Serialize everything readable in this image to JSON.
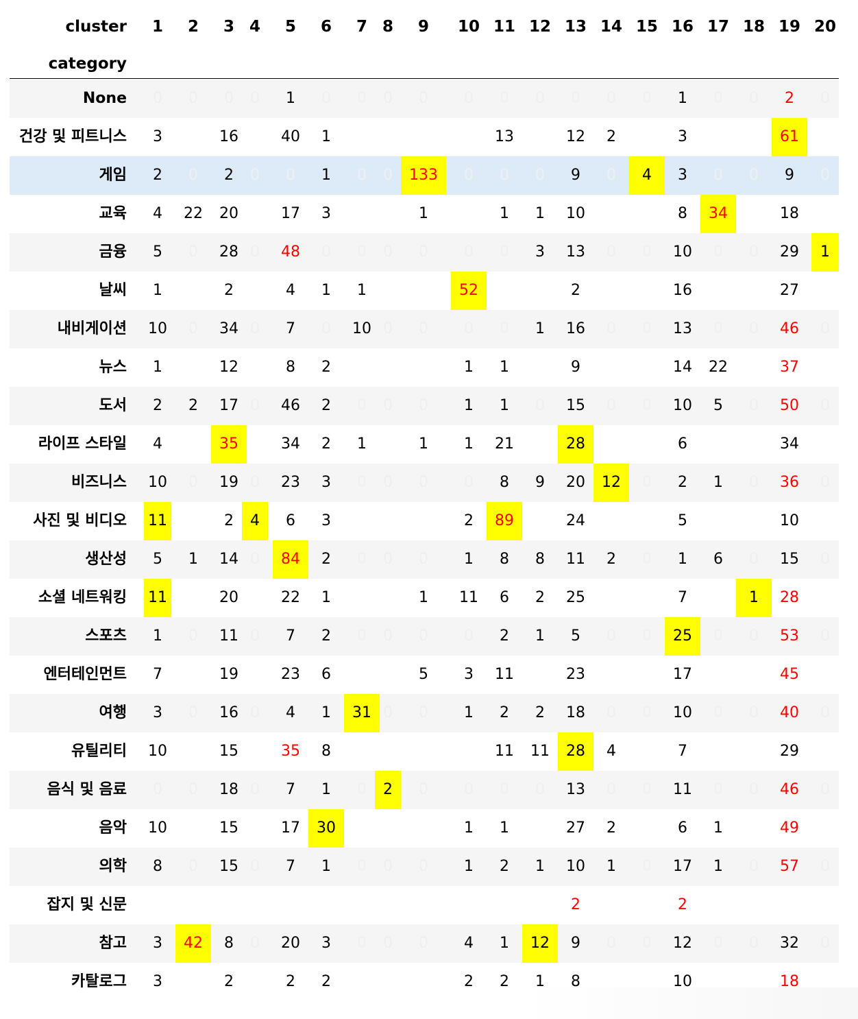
{
  "header": {
    "col_title": "cluster",
    "row_title": "category",
    "columns": [
      "1",
      "2",
      "3",
      "4",
      "5",
      "6",
      "7",
      "8",
      "9",
      "10",
      "11",
      "12",
      "13",
      "14",
      "15",
      "16",
      "17",
      "18",
      "19",
      "20"
    ]
  },
  "colors": {
    "highlight": "#ffff00",
    "max_text": "#ff0000",
    "zero_text": "#efefef",
    "stripe": "#f5f5f5",
    "hover_row": "#ddebf8"
  },
  "rows": [
    {
      "label": "None",
      "cells": [
        "0",
        "0",
        "0",
        "0",
        "1",
        "0",
        "0",
        "0",
        "0",
        "0",
        "0",
        "0",
        "0",
        "0",
        "0",
        "1",
        "0",
        "0",
        "2",
        "0"
      ],
      "red": [
        18
      ],
      "hl": []
    },
    {
      "label": "건강 및 피트니스",
      "cells": [
        "3",
        "",
        "16",
        "",
        "40",
        "1",
        "",
        "",
        "",
        "",
        "13",
        "",
        "12",
        "2",
        "",
        "3",
        "",
        "",
        "61",
        ""
      ],
      "red": [
        18
      ],
      "hl": [
        18
      ]
    },
    {
      "label": "게임",
      "cells": [
        "2",
        "0",
        "2",
        "0",
        "0",
        "1",
        "0",
        "0",
        "133",
        "0",
        "0",
        "0",
        "9",
        "0",
        "4",
        "3",
        "0",
        "0",
        "9",
        "0"
      ],
      "red": [
        8
      ],
      "hl": [
        8,
        14
      ],
      "hover": true
    },
    {
      "label": "교육",
      "cells": [
        "4",
        "22",
        "20",
        "",
        "17",
        "3",
        "",
        "",
        "1",
        "",
        "1",
        "1",
        "10",
        "",
        "",
        "8",
        "34",
        "",
        "18",
        ""
      ],
      "red": [
        16
      ],
      "hl": [
        16
      ]
    },
    {
      "label": "금융",
      "cells": [
        "5",
        "0",
        "28",
        "0",
        "48",
        "0",
        "0",
        "0",
        "0",
        "0",
        "0",
        "3",
        "13",
        "0",
        "0",
        "10",
        "0",
        "0",
        "29",
        "1"
      ],
      "red": [
        4
      ],
      "hl": [
        19
      ]
    },
    {
      "label": "날씨",
      "cells": [
        "1",
        "",
        "2",
        "",
        "4",
        "1",
        "1",
        "",
        "",
        "52",
        "",
        "",
        "2",
        "",
        "",
        "16",
        "",
        "",
        "27",
        ""
      ],
      "red": [
        9
      ],
      "hl": [
        9
      ]
    },
    {
      "label": "내비게이션",
      "cells": [
        "10",
        "0",
        "34",
        "0",
        "7",
        "0",
        "10",
        "0",
        "0",
        "0",
        "0",
        "1",
        "16",
        "0",
        "0",
        "13",
        "0",
        "0",
        "46",
        "0"
      ],
      "red": [
        18
      ],
      "hl": []
    },
    {
      "label": "뉴스",
      "cells": [
        "1",
        "",
        "12",
        "",
        "8",
        "2",
        "",
        "",
        "",
        "1",
        "1",
        "",
        "9",
        "",
        "",
        "14",
        "22",
        "",
        "37",
        ""
      ],
      "red": [
        18
      ],
      "hl": []
    },
    {
      "label": "도서",
      "cells": [
        "2",
        "2",
        "17",
        "0",
        "46",
        "2",
        "0",
        "0",
        "0",
        "1",
        "1",
        "0",
        "15",
        "0",
        "0",
        "10",
        "5",
        "0",
        "50",
        "0"
      ],
      "red": [
        18
      ],
      "hl": []
    },
    {
      "label": "라이프 스타일",
      "cells": [
        "4",
        "",
        "35",
        "",
        "34",
        "2",
        "1",
        "",
        "1",
        "1",
        "21",
        "",
        "28",
        "",
        "",
        "6",
        "",
        "",
        "34",
        ""
      ],
      "red": [
        2
      ],
      "hl": [
        2,
        12
      ]
    },
    {
      "label": "비즈니스",
      "cells": [
        "10",
        "0",
        "19",
        "0",
        "23",
        "3",
        "0",
        "0",
        "0",
        "0",
        "8",
        "9",
        "20",
        "12",
        "0",
        "2",
        "1",
        "0",
        "36",
        "0"
      ],
      "red": [
        18
      ],
      "hl": [
        13
      ]
    },
    {
      "label": "사진 및 비디오",
      "cells": [
        "11",
        "",
        "2",
        "4",
        "6",
        "3",
        "",
        "",
        "",
        "2",
        "89",
        "",
        "24",
        "",
        "",
        "5",
        "",
        "",
        "10",
        ""
      ],
      "red": [
        10
      ],
      "hl": [
        0,
        3,
        10
      ]
    },
    {
      "label": "생산성",
      "cells": [
        "5",
        "1",
        "14",
        "0",
        "84",
        "2",
        "0",
        "0",
        "0",
        "1",
        "8",
        "8",
        "11",
        "2",
        "0",
        "1",
        "6",
        "0",
        "15",
        "0"
      ],
      "red": [
        4
      ],
      "hl": [
        4
      ]
    },
    {
      "label": "소셜 네트워킹",
      "cells": [
        "11",
        "",
        "20",
        "",
        "22",
        "1",
        "",
        "",
        "1",
        "11",
        "6",
        "2",
        "25",
        "",
        "",
        "7",
        "",
        "1",
        "28",
        ""
      ],
      "red": [
        18
      ],
      "hl": [
        0,
        17
      ]
    },
    {
      "label": "스포츠",
      "cells": [
        "1",
        "0",
        "11",
        "0",
        "7",
        "2",
        "0",
        "0",
        "0",
        "0",
        "2",
        "1",
        "5",
        "0",
        "0",
        "25",
        "0",
        "0",
        "53",
        "0"
      ],
      "red": [
        18
      ],
      "hl": [
        15
      ]
    },
    {
      "label": "엔터테인먼트",
      "cells": [
        "7",
        "",
        "19",
        "",
        "23",
        "6",
        "",
        "",
        "5",
        "3",
        "11",
        "",
        "23",
        "",
        "",
        "17",
        "",
        "",
        "45",
        ""
      ],
      "red": [
        18
      ],
      "hl": []
    },
    {
      "label": "여행",
      "cells": [
        "3",
        "0",
        "16",
        "0",
        "4",
        "1",
        "31",
        "0",
        "0",
        "1",
        "2",
        "2",
        "18",
        "0",
        "0",
        "10",
        "0",
        "0",
        "40",
        "0"
      ],
      "red": [
        18
      ],
      "hl": [
        6
      ]
    },
    {
      "label": "유틸리티",
      "cells": [
        "10",
        "",
        "15",
        "",
        "35",
        "8",
        "",
        "",
        "",
        "",
        "11",
        "11",
        "28",
        "4",
        "",
        "7",
        "",
        "",
        "29",
        ""
      ],
      "red": [
        4
      ],
      "hl": [
        12
      ]
    },
    {
      "label": "음식 및 음료",
      "cells": [
        "0",
        "0",
        "18",
        "0",
        "7",
        "1",
        "0",
        "2",
        "0",
        "0",
        "0",
        "0",
        "13",
        "0",
        "0",
        "11",
        "0",
        "0",
        "46",
        "0"
      ],
      "red": [
        18
      ],
      "hl": [
        7
      ]
    },
    {
      "label": "음악",
      "cells": [
        "10",
        "",
        "15",
        "",
        "17",
        "30",
        "",
        "",
        "",
        "1",
        "1",
        "",
        "27",
        "2",
        "",
        "6",
        "1",
        "",
        "49",
        ""
      ],
      "red": [
        18
      ],
      "hl": [
        5
      ]
    },
    {
      "label": "의학",
      "cells": [
        "8",
        "0",
        "15",
        "0",
        "7",
        "1",
        "0",
        "0",
        "0",
        "1",
        "2",
        "1",
        "10",
        "1",
        "0",
        "17",
        "1",
        "0",
        "57",
        "0"
      ],
      "red": [
        18
      ],
      "hl": []
    },
    {
      "label": "잡지 및 신문",
      "cells": [
        "",
        "",
        "",
        "",
        "",
        "",
        "",
        "",
        "",
        "",
        "",
        "",
        "2",
        "",
        "",
        "2",
        "",
        "",
        "",
        ""
      ],
      "red": [
        12,
        15
      ],
      "hl": []
    },
    {
      "label": "참고",
      "cells": [
        "3",
        "42",
        "8",
        "0",
        "20",
        "3",
        "0",
        "0",
        "0",
        "4",
        "1",
        "12",
        "9",
        "0",
        "0",
        "12",
        "0",
        "0",
        "32",
        "0"
      ],
      "red": [
        1
      ],
      "hl": [
        1,
        11
      ]
    },
    {
      "label": "카탈로그",
      "cells": [
        "3",
        "",
        "2",
        "",
        "2",
        "2",
        "",
        "",
        "",
        "2",
        "2",
        "1",
        "8",
        "",
        "",
        "10",
        "",
        "",
        "18",
        ""
      ],
      "red": [
        18
      ],
      "hl": []
    }
  ]
}
